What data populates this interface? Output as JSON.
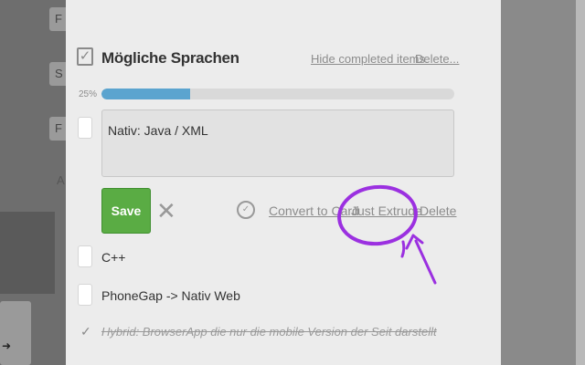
{
  "checklist": {
    "title": "Mögliche Sprachen",
    "hide_completed_label": "Hide completed items.",
    "delete_label": "Delete...",
    "progress_label": "25%",
    "progress_fraction": 0.25
  },
  "editing_item": {
    "value": "Nativ: Java / XML",
    "save_label": "Save",
    "convert_label": "Convert to Card",
    "extrude_label": "Just Extrude",
    "delete_label": "Delete"
  },
  "items": [
    {
      "text": "C++",
      "done": false
    },
    {
      "text": "PhoneGap -> Nativ Web",
      "done": false
    },
    {
      "text": "Hybrid: BrowserApp die nur die mobile Version der Seit darstellt",
      "done": true
    }
  ],
  "background_board": {
    "card_letters": [
      "F",
      "S",
      "F"
    ],
    "add_letter": "A"
  },
  "colors": {
    "progress": "#5ba4cf",
    "save_button": "#5aac44",
    "annotation": "#9b30e0"
  },
  "icons": {
    "checklist": "checkbox-icon",
    "cancel": "close-icon",
    "convert": "circle-check-icon",
    "completed": "check-icon",
    "board_side": "arrow-icon"
  }
}
